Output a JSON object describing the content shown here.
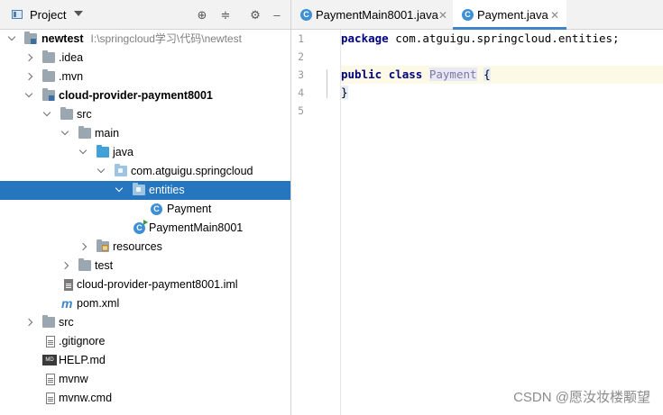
{
  "project_panel": {
    "title": "Project",
    "buttons": [
      "locate-icon",
      "collapse-icon",
      "gear-icon",
      "hide-icon"
    ],
    "tree": [
      {
        "label": "newtest",
        "path": "I:\\springcloud学习\\代码\\newtest",
        "bold": true,
        "expanded": true,
        "icon": "module-folder"
      },
      {
        "label": ".idea",
        "expanded": false,
        "icon": "folder"
      },
      {
        "label": ".mvn",
        "expanded": false,
        "icon": "folder"
      },
      {
        "label": "cloud-provider-payment8001",
        "bold": true,
        "expanded": true,
        "icon": "module-folder"
      },
      {
        "label": "src",
        "expanded": true,
        "icon": "folder"
      },
      {
        "label": "main",
        "expanded": true,
        "icon": "folder"
      },
      {
        "label": "java",
        "expanded": true,
        "icon": "source-folder"
      },
      {
        "label": "com.atguigu.springcloud",
        "expanded": true,
        "icon": "package"
      },
      {
        "label": "entities",
        "expanded": true,
        "selected": true,
        "icon": "package"
      },
      {
        "label": "Payment",
        "icon": "class"
      },
      {
        "label": "PaymentMain8001",
        "icon": "runnable-class"
      },
      {
        "label": "resources",
        "expanded": false,
        "icon": "resources-folder"
      },
      {
        "label": "test",
        "expanded": false,
        "icon": "folder"
      },
      {
        "label": "cloud-provider-payment8001.iml",
        "icon": "iml-file"
      },
      {
        "label": "pom.xml",
        "icon": "maven-file"
      },
      {
        "label": "src",
        "expanded": false,
        "icon": "folder"
      },
      {
        "label": ".gitignore",
        "icon": "gitignore-file"
      },
      {
        "label": "HELP.md",
        "icon": "markdown-file"
      },
      {
        "label": "mvnw",
        "icon": "text-file"
      },
      {
        "label": "mvnw.cmd",
        "icon": "text-file"
      }
    ]
  },
  "editor": {
    "tabs": [
      {
        "label": "PaymentMain8001.java",
        "active": false
      },
      {
        "label": "Payment.java",
        "active": true
      }
    ],
    "line_numbers": [
      "1",
      "2",
      "3",
      "4",
      "5"
    ],
    "code": {
      "line1_kw": "package",
      "line1_rest": " com.atguigu.springcloud.entities;",
      "line3_kw1": "public",
      "line3_kw2": "class",
      "line3_cls": "Payment",
      "line3_brace": "{",
      "line4_brace": "}"
    }
  },
  "watermark": "CSDN @愿汝妆楼颙望",
  "colors": {
    "selection": "#2675bf",
    "keyword": "#000080",
    "active_tab": "#4083c9"
  }
}
